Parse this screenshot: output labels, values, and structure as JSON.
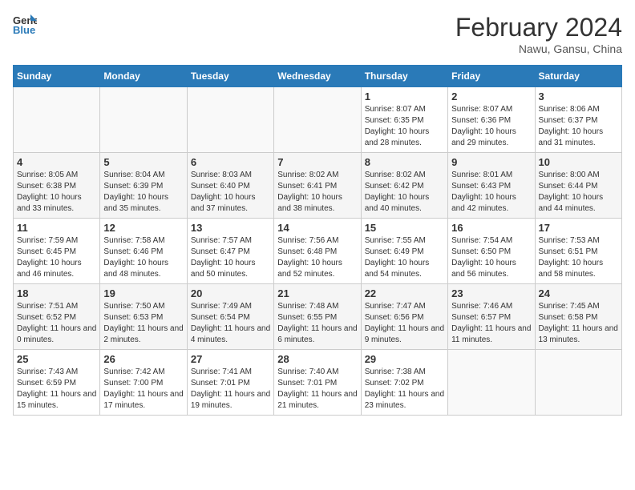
{
  "header": {
    "logo_general": "General",
    "logo_blue": "Blue",
    "month_year": "February 2024",
    "location": "Nawu, Gansu, China"
  },
  "days_of_week": [
    "Sunday",
    "Monday",
    "Tuesday",
    "Wednesday",
    "Thursday",
    "Friday",
    "Saturday"
  ],
  "weeks": [
    [
      {
        "day": "",
        "info": ""
      },
      {
        "day": "",
        "info": ""
      },
      {
        "day": "",
        "info": ""
      },
      {
        "day": "",
        "info": ""
      },
      {
        "day": "1",
        "info": "Sunrise: 8:07 AM\nSunset: 6:35 PM\nDaylight: 10 hours and 28 minutes."
      },
      {
        "day": "2",
        "info": "Sunrise: 8:07 AM\nSunset: 6:36 PM\nDaylight: 10 hours and 29 minutes."
      },
      {
        "day": "3",
        "info": "Sunrise: 8:06 AM\nSunset: 6:37 PM\nDaylight: 10 hours and 31 minutes."
      }
    ],
    [
      {
        "day": "4",
        "info": "Sunrise: 8:05 AM\nSunset: 6:38 PM\nDaylight: 10 hours and 33 minutes."
      },
      {
        "day": "5",
        "info": "Sunrise: 8:04 AM\nSunset: 6:39 PM\nDaylight: 10 hours and 35 minutes."
      },
      {
        "day": "6",
        "info": "Sunrise: 8:03 AM\nSunset: 6:40 PM\nDaylight: 10 hours and 37 minutes."
      },
      {
        "day": "7",
        "info": "Sunrise: 8:02 AM\nSunset: 6:41 PM\nDaylight: 10 hours and 38 minutes."
      },
      {
        "day": "8",
        "info": "Sunrise: 8:02 AM\nSunset: 6:42 PM\nDaylight: 10 hours and 40 minutes."
      },
      {
        "day": "9",
        "info": "Sunrise: 8:01 AM\nSunset: 6:43 PM\nDaylight: 10 hours and 42 minutes."
      },
      {
        "day": "10",
        "info": "Sunrise: 8:00 AM\nSunset: 6:44 PM\nDaylight: 10 hours and 44 minutes."
      }
    ],
    [
      {
        "day": "11",
        "info": "Sunrise: 7:59 AM\nSunset: 6:45 PM\nDaylight: 10 hours and 46 minutes."
      },
      {
        "day": "12",
        "info": "Sunrise: 7:58 AM\nSunset: 6:46 PM\nDaylight: 10 hours and 48 minutes."
      },
      {
        "day": "13",
        "info": "Sunrise: 7:57 AM\nSunset: 6:47 PM\nDaylight: 10 hours and 50 minutes."
      },
      {
        "day": "14",
        "info": "Sunrise: 7:56 AM\nSunset: 6:48 PM\nDaylight: 10 hours and 52 minutes."
      },
      {
        "day": "15",
        "info": "Sunrise: 7:55 AM\nSunset: 6:49 PM\nDaylight: 10 hours and 54 minutes."
      },
      {
        "day": "16",
        "info": "Sunrise: 7:54 AM\nSunset: 6:50 PM\nDaylight: 10 hours and 56 minutes."
      },
      {
        "day": "17",
        "info": "Sunrise: 7:53 AM\nSunset: 6:51 PM\nDaylight: 10 hours and 58 minutes."
      }
    ],
    [
      {
        "day": "18",
        "info": "Sunrise: 7:51 AM\nSunset: 6:52 PM\nDaylight: 11 hours and 0 minutes."
      },
      {
        "day": "19",
        "info": "Sunrise: 7:50 AM\nSunset: 6:53 PM\nDaylight: 11 hours and 2 minutes."
      },
      {
        "day": "20",
        "info": "Sunrise: 7:49 AM\nSunset: 6:54 PM\nDaylight: 11 hours and 4 minutes."
      },
      {
        "day": "21",
        "info": "Sunrise: 7:48 AM\nSunset: 6:55 PM\nDaylight: 11 hours and 6 minutes."
      },
      {
        "day": "22",
        "info": "Sunrise: 7:47 AM\nSunset: 6:56 PM\nDaylight: 11 hours and 9 minutes."
      },
      {
        "day": "23",
        "info": "Sunrise: 7:46 AM\nSunset: 6:57 PM\nDaylight: 11 hours and 11 minutes."
      },
      {
        "day": "24",
        "info": "Sunrise: 7:45 AM\nSunset: 6:58 PM\nDaylight: 11 hours and 13 minutes."
      }
    ],
    [
      {
        "day": "25",
        "info": "Sunrise: 7:43 AM\nSunset: 6:59 PM\nDaylight: 11 hours and 15 minutes."
      },
      {
        "day": "26",
        "info": "Sunrise: 7:42 AM\nSunset: 7:00 PM\nDaylight: 11 hours and 17 minutes."
      },
      {
        "day": "27",
        "info": "Sunrise: 7:41 AM\nSunset: 7:01 PM\nDaylight: 11 hours and 19 minutes."
      },
      {
        "day": "28",
        "info": "Sunrise: 7:40 AM\nSunset: 7:01 PM\nDaylight: 11 hours and 21 minutes."
      },
      {
        "day": "29",
        "info": "Sunrise: 7:38 AM\nSunset: 7:02 PM\nDaylight: 11 hours and 23 minutes."
      },
      {
        "day": "",
        "info": ""
      },
      {
        "day": "",
        "info": ""
      }
    ]
  ]
}
